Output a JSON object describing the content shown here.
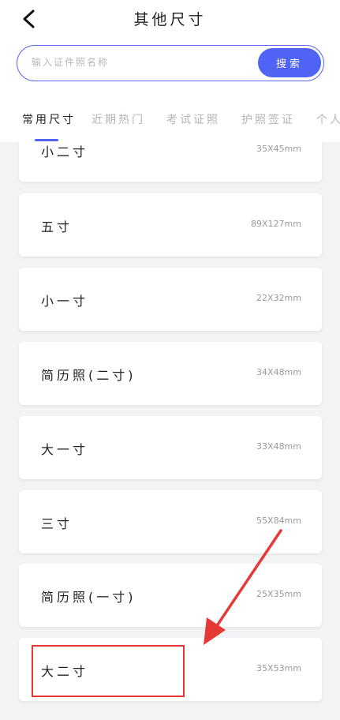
{
  "header": {
    "title": "其他尺寸"
  },
  "search": {
    "placeholder": "输入证件照名称",
    "button_label": "搜索"
  },
  "tabs": [
    {
      "label": "常用尺寸",
      "active": true
    },
    {
      "label": "近期热门",
      "active": false
    },
    {
      "label": "考试证照",
      "active": false
    },
    {
      "label": "护照签证",
      "active": false
    },
    {
      "label": "个人",
      "active": false
    }
  ],
  "sizes": [
    {
      "name": "小二寸",
      "dims": "35X45mm"
    },
    {
      "name": "五寸",
      "dims": "89X127mm"
    },
    {
      "name": "小一寸",
      "dims": "22X32mm"
    },
    {
      "name": "简历照(二寸)",
      "dims": "34X48mm"
    },
    {
      "name": "大一寸",
      "dims": "33X48mm"
    },
    {
      "name": "三寸",
      "dims": "55X84mm"
    },
    {
      "name": "简历照(一寸)",
      "dims": "25X35mm"
    },
    {
      "name": "大二寸",
      "dims": "35X53mm"
    }
  ],
  "colors": {
    "accent": "#4f63f5",
    "annotation": "#e53935"
  }
}
